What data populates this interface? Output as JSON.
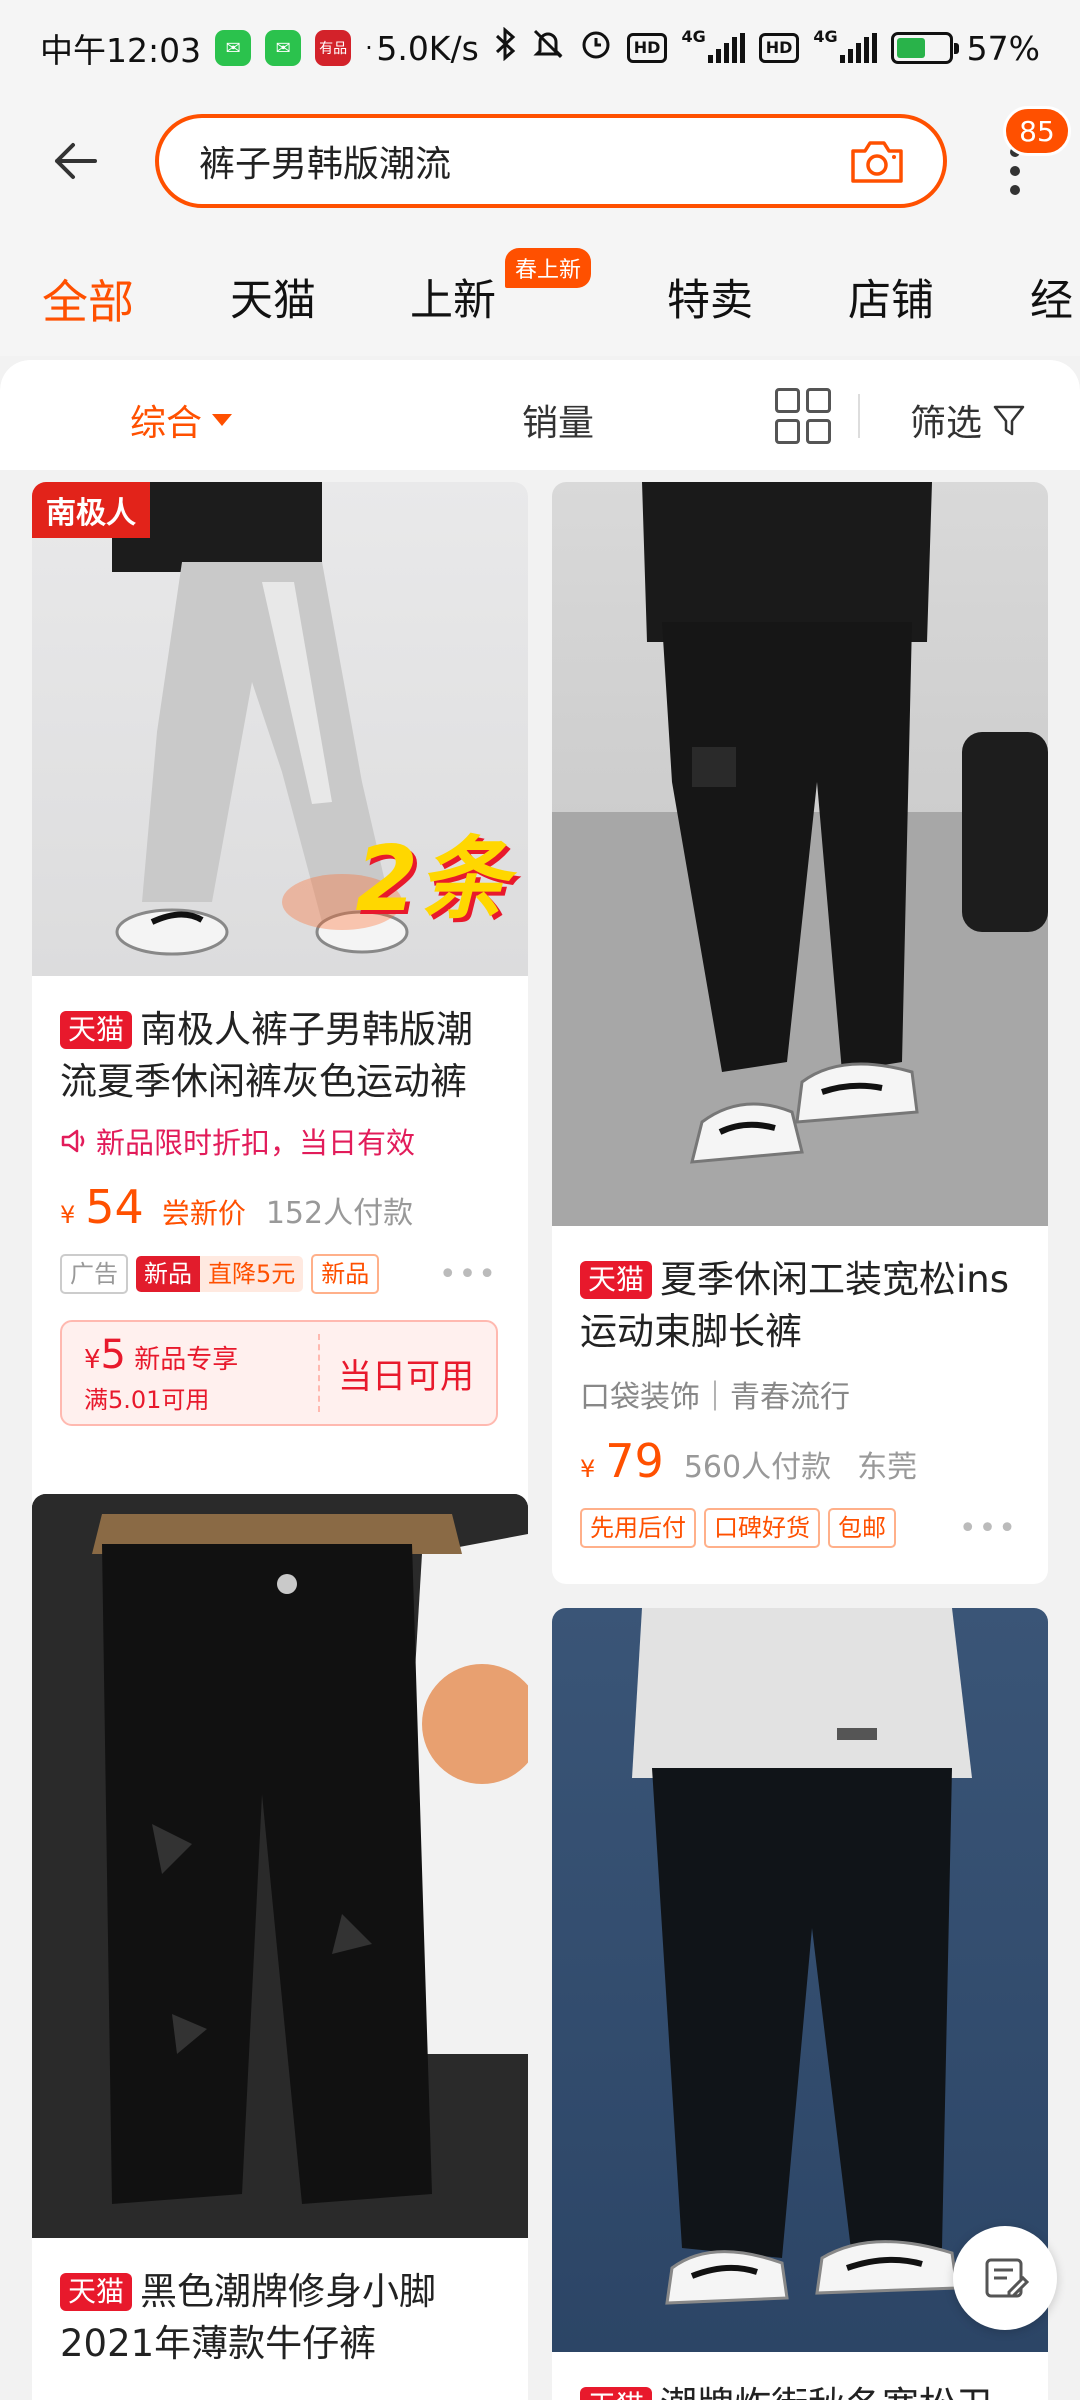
{
  "status_bar": {
    "time": "中午12:03",
    "app_badge": "有品",
    "dot": "·",
    "net_speed": "5.0K/s",
    "hd1": "HD",
    "hd2": "HD",
    "net1": "4G",
    "net2": "4G",
    "battery": "57%",
    "battery_level": 0.57
  },
  "search": {
    "query": "裤子男韩版潮流",
    "message_count": "85"
  },
  "tabs": [
    "全部",
    "天猫",
    "上新",
    "特卖",
    "店铺",
    "经"
  ],
  "active_tab": 0,
  "tab_tag": "春上新",
  "sort": {
    "items": [
      "综合",
      "销量",
      "筛选"
    ],
    "active": 0
  },
  "colors": {
    "accent": "#ff5000",
    "tmall_red": "#e8192c",
    "promo_pink": "#e21c5a"
  },
  "products": [
    {
      "brand_logo": "南极人",
      "image_caption": "2条",
      "tmall": "天猫",
      "title": "南极人裤子男韩版潮流夏季休闲裤灰色运动裤",
      "promo": "新品限时折扣，当日有效",
      "currency": "¥",
      "price": "54",
      "price_note": "尝新价",
      "sales": "152人付款",
      "tags": [
        "广告",
        "新品",
        "直降5元",
        "新品"
      ],
      "coupon": {
        "currency": "¥",
        "amount": "5",
        "label": "新品专享",
        "condition": "满5.01可用",
        "action": "当日可用"
      }
    },
    {
      "tmall": "天猫",
      "title": "夏季休闲工装宽松ins运动束脚长裤",
      "subinfo": "口袋装饰｜青春流行",
      "currency": "¥",
      "price": "79",
      "sales": "560人付款",
      "location": "东莞",
      "tags": [
        "先用后付",
        "口碑好货",
        "包邮"
      ]
    },
    {
      "tmall": "天猫",
      "title": "黑色潮牌修身小脚2021年薄款牛仔裤"
    },
    {
      "tmall": "天猫",
      "title": "潮牌炸街秋冬宽松卫"
    }
  ]
}
